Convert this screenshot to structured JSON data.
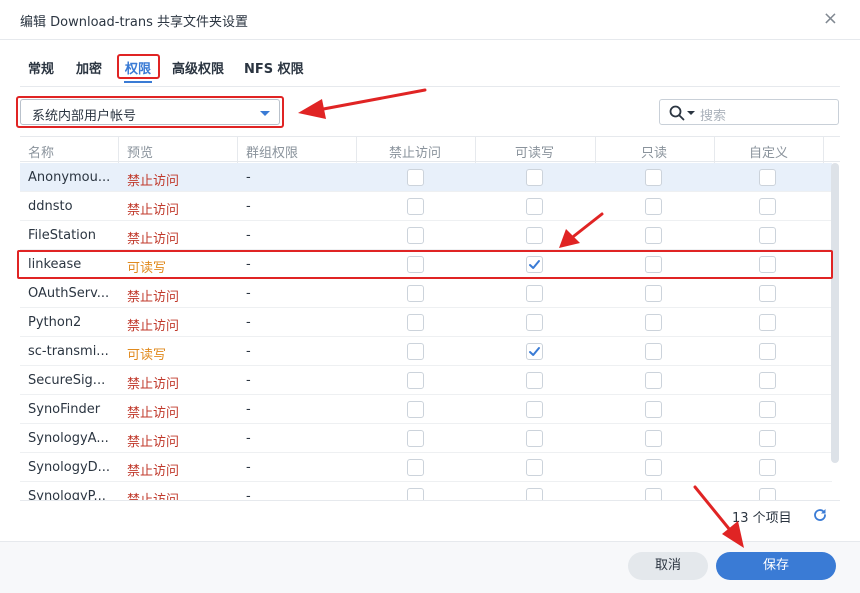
{
  "dialog": {
    "title": "编辑 Download-trans 共享文件夹设置",
    "close_glyph": "×"
  },
  "tabs": [
    {
      "label": "常规"
    },
    {
      "label": "加密"
    },
    {
      "label": "权限",
      "active": true
    },
    {
      "label": "高级权限"
    },
    {
      "label": "NFS 权限"
    }
  ],
  "user_type_select": {
    "value": "系统内部用户帐号"
  },
  "search": {
    "placeholder": "搜索"
  },
  "columns": [
    "名称",
    "预览",
    "群组权限",
    "禁止访问",
    "可读写",
    "只读",
    "自定义"
  ],
  "rows": [
    {
      "name": "Anonymou...",
      "preview": "禁止访问",
      "group": "-",
      "deny": false,
      "rw": false,
      "ro": false,
      "custom": false
    },
    {
      "name": "ddnsto",
      "preview": "禁止访问",
      "group": "-",
      "deny": false,
      "rw": false,
      "ro": false,
      "custom": false
    },
    {
      "name": "FileStation",
      "preview": "禁止访问",
      "group": "-",
      "deny": false,
      "rw": false,
      "ro": false,
      "custom": false
    },
    {
      "name": "linkease",
      "preview": "可读写",
      "group": "-",
      "deny": false,
      "rw": true,
      "ro": false,
      "custom": false
    },
    {
      "name": "OAuthServ...",
      "preview": "禁止访问",
      "group": "-",
      "deny": false,
      "rw": false,
      "ro": false,
      "custom": false
    },
    {
      "name": "Python2",
      "preview": "禁止访问",
      "group": "-",
      "deny": false,
      "rw": false,
      "ro": false,
      "custom": false
    },
    {
      "name": "sc-transmi...",
      "preview": "可读写",
      "group": "-",
      "deny": false,
      "rw": true,
      "ro": false,
      "custom": false
    },
    {
      "name": "SecureSig...",
      "preview": "禁止访问",
      "group": "-",
      "deny": false,
      "rw": false,
      "ro": false,
      "custom": false
    },
    {
      "name": "SynoFinder",
      "preview": "禁止访问",
      "group": "-",
      "deny": false,
      "rw": false,
      "ro": false,
      "custom": false
    },
    {
      "name": "SynologyA...",
      "preview": "禁止访问",
      "group": "-",
      "deny": false,
      "rw": false,
      "ro": false,
      "custom": false
    },
    {
      "name": "SynologyD...",
      "preview": "禁止访问",
      "group": "-",
      "deny": false,
      "rw": false,
      "ro": false,
      "custom": false
    },
    {
      "name": "SynologyP...",
      "preview": "禁止访问",
      "group": "-",
      "deny": false,
      "rw": false,
      "ro": false,
      "custom": false
    }
  ],
  "footer": {
    "item_count": "13 个项目",
    "cancel_label": "取消",
    "save_label": "保存"
  },
  "colors": {
    "accent": "#3a7bd5",
    "deny_text": "#c0392b",
    "rw_text": "#e08a1e",
    "annotation_red": "#e02424"
  }
}
